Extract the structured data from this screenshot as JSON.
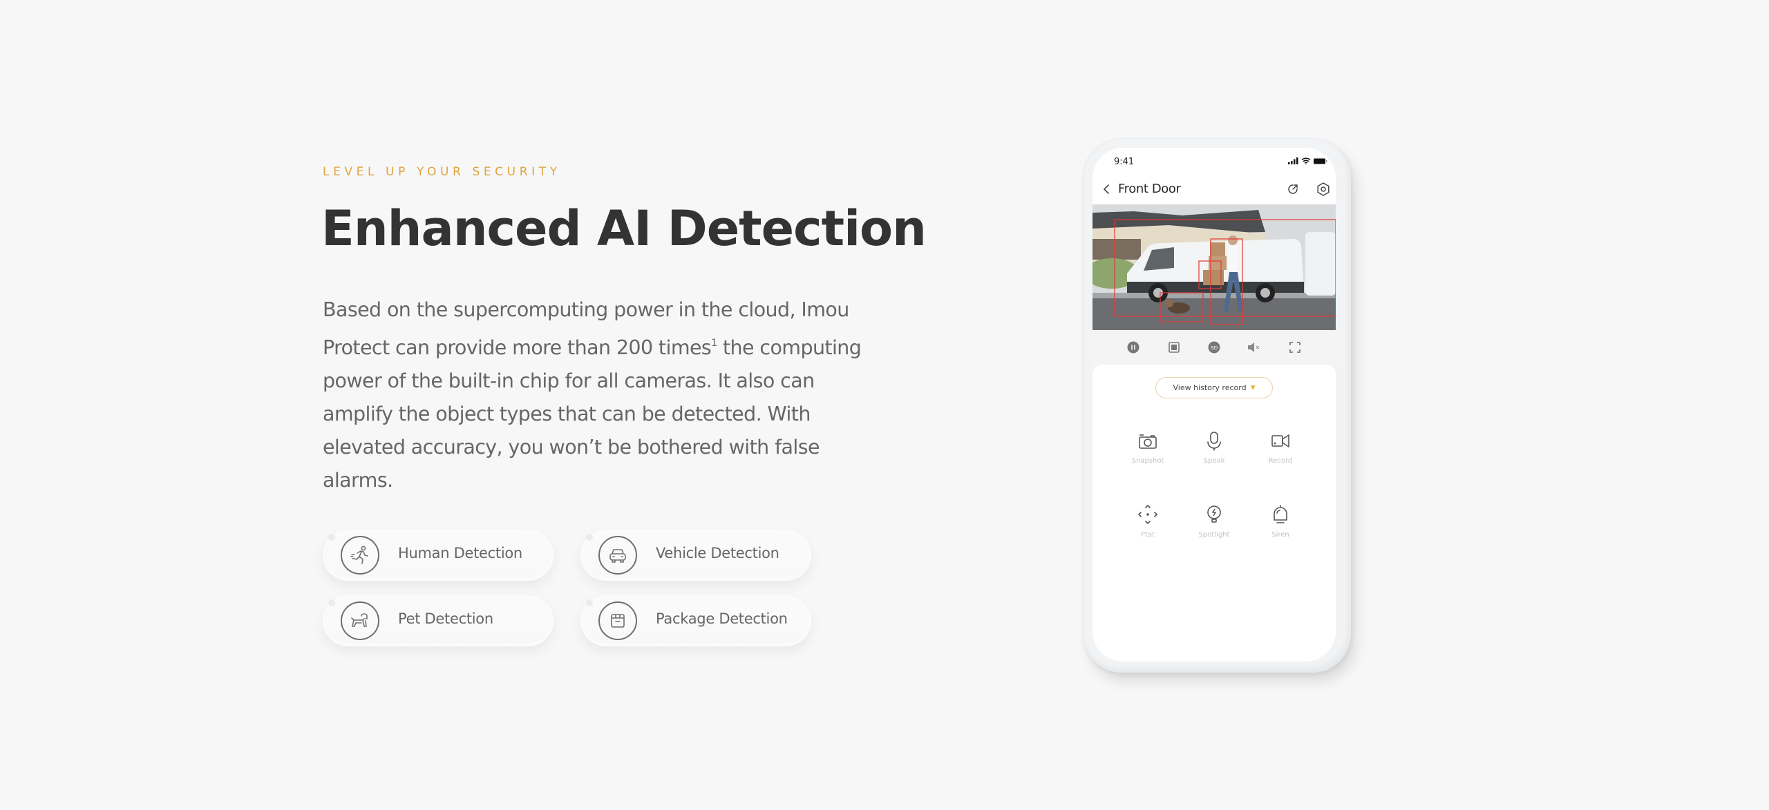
{
  "hero": {
    "eyebrow": "LEVEL UP YOUR SECURITY",
    "title": "Enhanced AI Detection",
    "body_before_sup": "Based on the supercomputing power in the cloud, Imou Protect can provide more than 200 times",
    "body_sup": "1",
    "body_after_sup": " the computing power of the built-in chip for all cameras. It also can amplify the object types that can be detected. With elevated accuracy, you won’t be bothered with false alarms.",
    "accent_color": "#e0a43e"
  },
  "features": [
    {
      "label": "Human Detection",
      "icon": "running-person-icon"
    },
    {
      "label": "Vehicle Detection",
      "icon": "car-icon"
    },
    {
      "label": "Pet Detection",
      "icon": "dog-icon"
    },
    {
      "label": "Package Detection",
      "icon": "box-icon"
    }
  ],
  "phone": {
    "status": {
      "time": "9:41"
    },
    "nav": {
      "title": "Front Door"
    },
    "video": {
      "detections": [
        "scene",
        "person",
        "package",
        "pet"
      ]
    },
    "controls": [
      "pause-icon",
      "stop-icon",
      "sd-quality-icon",
      "mute-icon",
      "fullscreen-icon"
    ],
    "controls_sd_text": "SD",
    "history_button": {
      "label": "View  history record",
      "accent": "#f0b53f"
    },
    "tools": [
      {
        "label": "Snapshot",
        "icon": "camera-icon"
      },
      {
        "label": "Speak",
        "icon": "microphone-icon"
      },
      {
        "label": "Record",
        "icon": "video-record-icon"
      },
      {
        "label": "Ptat",
        "icon": "pan-tilt-icon"
      },
      {
        "label": "Spotlight",
        "icon": "spotlight-icon"
      },
      {
        "label": "Siren",
        "icon": "siren-icon"
      }
    ]
  }
}
